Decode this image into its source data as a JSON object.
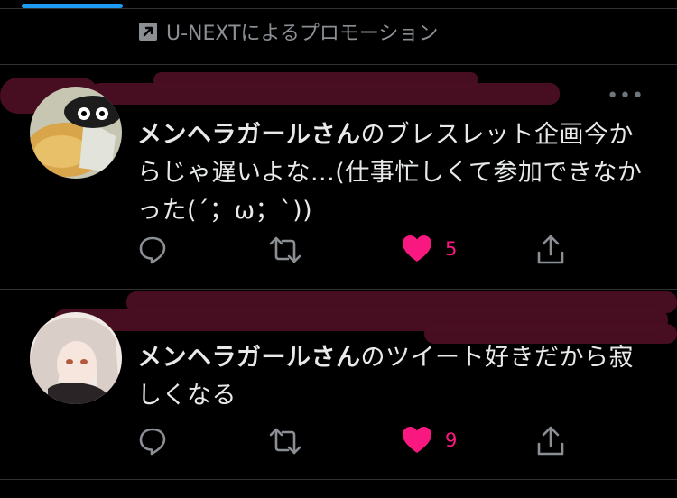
{
  "promo": {
    "text": "U-NEXTによるプロモーション",
    "icon": "promoted-arrow-icon"
  },
  "tweets": [
    {
      "mention": "メンヘラガールさん",
      "text": "のブレスレット企画今からじゃ遅いよな...(仕事忙しくて参加できなかった(´；ω；`))",
      "like_count": "5",
      "liked": true
    },
    {
      "mention": "メンヘラガールさん",
      "text": "のツイート好きだから寂しくなる",
      "like_count": "9",
      "liked": true
    }
  ],
  "colors": {
    "background": "#000000",
    "text": "#e7e9ea",
    "muted": "#8b8f94",
    "like": "#f91880",
    "accent": "#1d9bf0"
  }
}
